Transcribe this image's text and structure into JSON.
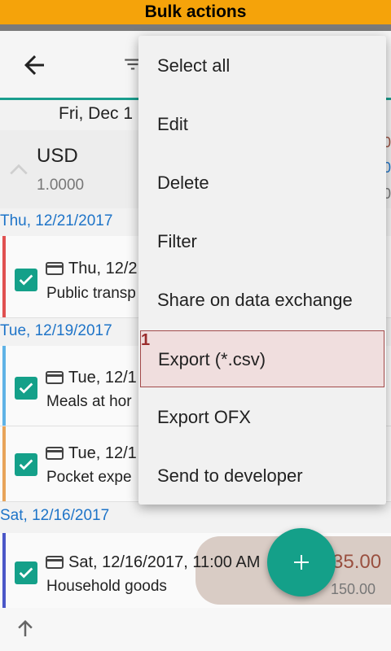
{
  "banner": {
    "title": "Bulk actions"
  },
  "header": {
    "date": "Fri, Dec 1"
  },
  "currency": {
    "code": "USD",
    "rate": "1.0000",
    "peek": [
      "0",
      "0",
      "0"
    ]
  },
  "groups": [
    {
      "date": "Thu, 12/21/2017"
    },
    {
      "date": "Tue, 12/19/2017"
    },
    {
      "date": "Sat, 12/16/2017"
    }
  ],
  "transactions": [
    {
      "title": "Thu, 12/2",
      "note": "Public transp",
      "accent": "#e05050"
    },
    {
      "title": "Tue, 12/1",
      "note": "Meals at hor",
      "accent": "#5fb3e6"
    },
    {
      "title": "Tue, 12/1",
      "note": "Pocket expe",
      "accent": "#e8a45a"
    },
    {
      "title": "Sat, 12/16/2017, 11:00 AM",
      "note": "Household goods",
      "accent": "#4b57c8",
      "amount": "35.00",
      "amount_sub": "150.00"
    }
  ],
  "menu": {
    "items": [
      {
        "label": "Select all"
      },
      {
        "label": "Edit"
      },
      {
        "label": "Delete"
      },
      {
        "label": "Filter"
      },
      {
        "label": "Share on data exchange"
      },
      {
        "label": "Export (*.csv)"
      },
      {
        "label": "Export OFX"
      },
      {
        "label": "Send to developer"
      }
    ],
    "step_badge": "1"
  },
  "colors": {
    "accent": "#14a089",
    "banner": "#f5a30a",
    "date_blue": "#1e74c8",
    "highlight_border": "#a24a4a"
  }
}
